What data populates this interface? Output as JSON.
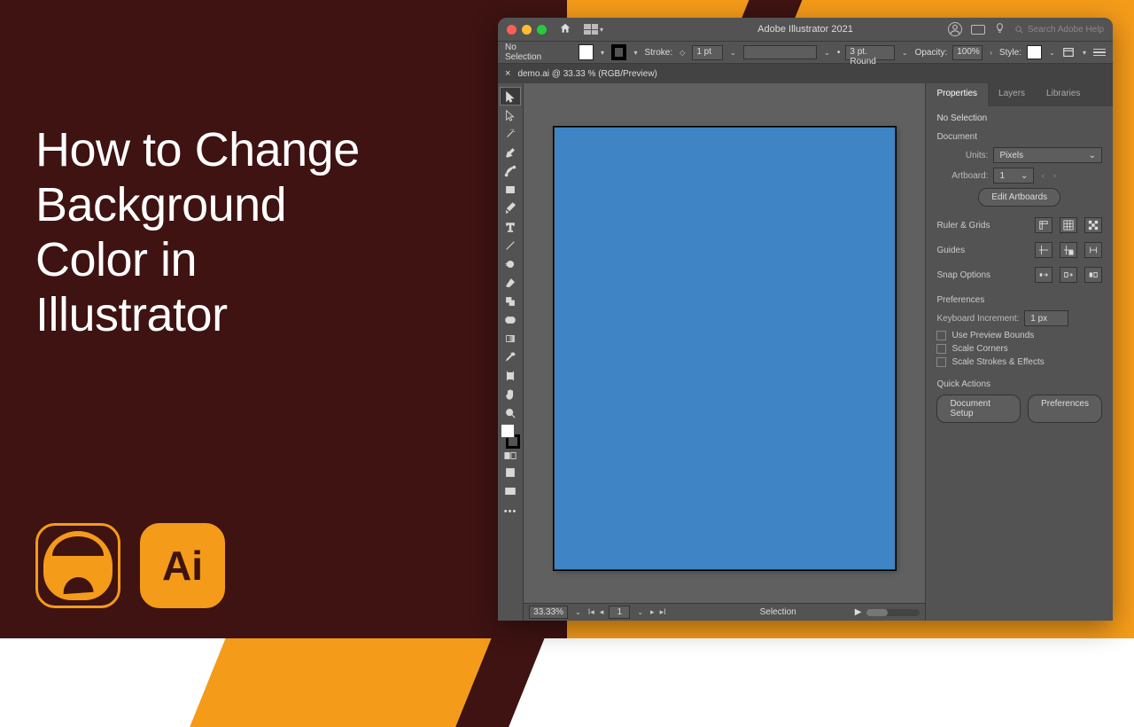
{
  "headline": "How to Change\nBackground\nColor in\nIllustrator",
  "badge_ai": "Ai",
  "titlebar": {
    "title": "Adobe Illustrator 2021",
    "search_placeholder": "Search Adobe Help"
  },
  "control": {
    "selection": "No Selection",
    "stroke_label": "Stroke:",
    "stroke_weight": "1 pt",
    "profile": "3 pt. Round",
    "opacity_label": "Opacity:",
    "opacity_value": "100%",
    "style_label": "Style:"
  },
  "tab": {
    "label": "demo.ai @ 33.33 % (RGB/Preview)"
  },
  "status": {
    "zoom": "33.33%",
    "artboard": "1",
    "mode": "Selection"
  },
  "panel": {
    "tabs": [
      "Properties",
      "Layers",
      "Libraries"
    ],
    "nosel": "No Selection",
    "document": "Document",
    "units_label": "Units:",
    "units_value": "Pixels",
    "artboard_label": "Artboard:",
    "artboard_value": "1",
    "edit_artboards": "Edit Artboards",
    "ruler_grids": "Ruler & Grids",
    "guides": "Guides",
    "snap_options": "Snap Options",
    "preferences": "Preferences",
    "keyboard_increment": "Keyboard Increment:",
    "keyboard_increment_value": "1 px",
    "use_preview_bounds": "Use Preview Bounds",
    "scale_corners": "Scale Corners",
    "scale_strokes": "Scale Strokes & Effects",
    "quick_actions": "Quick Actions",
    "document_setup": "Document Setup",
    "preferences_btn": "Preferences"
  }
}
